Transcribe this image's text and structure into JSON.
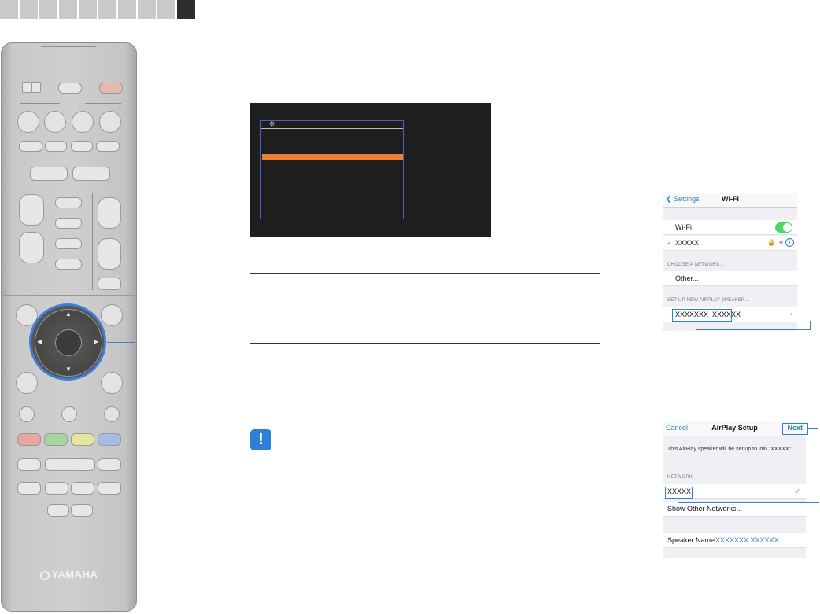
{
  "remote": {
    "brand": "YAMAHA"
  },
  "tv_screen": {
    "icon": "network-icon"
  },
  "phone_wifi": {
    "back_label": "Settings",
    "title": "Wi-Fi",
    "wifi_label": "Wi-Fi",
    "connected_network": "XXXXX",
    "section_choose": "CHOOSE A NETWORK...",
    "other_label": "Other...",
    "section_airplay": "SET UP NEW AIRPLAY SPEAKER...",
    "airplay_speaker": "XXXXXXX_XXXXXX"
  },
  "phone_airplay": {
    "cancel_label": "Cancel",
    "title": "AirPlay Setup",
    "next_label": "Next",
    "message": "This AirPlay speaker will be set up to join \"XXXXX\".",
    "section_network": "NETWORK",
    "network_name": "XXXXX",
    "show_other_label": "Show Other Networks...",
    "speaker_name_label": "Speaker Name",
    "speaker_name_value": "XXXXXXX XXXXXX"
  },
  "notice_icon": "!",
  "colors": {
    "accent_blue": "#2f7fd6",
    "tv_highlight": "#ee7d32",
    "toggle_on": "#4cd964"
  }
}
